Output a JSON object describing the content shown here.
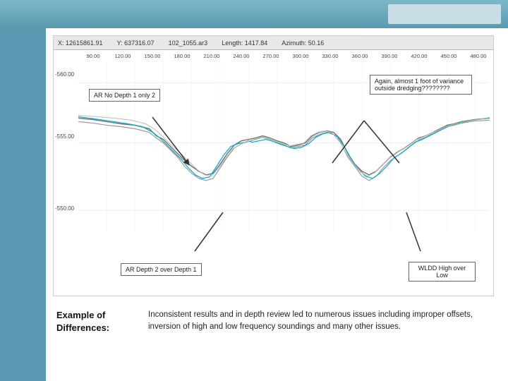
{
  "topbar": {
    "right_placeholder": ""
  },
  "chart": {
    "toolbar": {
      "x_coord": "X: 12615861.91",
      "y_coord": "Y: 637316.07",
      "filename": "102_1055.ar3",
      "length_label": "Length: 1417.84",
      "azimuth_label": "Azimuth: 50.16"
    },
    "x_labels": [
      "90.00",
      "120.00",
      "150.00",
      "180.00",
      "210.00",
      "240.00",
      "270.00",
      "300.00",
      "330.00",
      "360.00",
      "390.00",
      "420.00",
      "450.00",
      "480.00"
    ],
    "y_labels": [
      {
        "value": "-560.00",
        "position": 0.12
      },
      {
        "value": "-555.00",
        "position": 0.45
      },
      {
        "value": "-550.00",
        "position": 0.83
      }
    ],
    "annotations": {
      "ar_no_depth": "AR No Depth 1 only 2",
      "almost_1_foot": "Again, almost 1 foot of variance outside dredging????????",
      "ar_depth_2": "AR Depth 2 over Depth 1",
      "wldd_high": "WLDD High over Low"
    }
  },
  "bottom": {
    "label": "Example of\nDifferences:",
    "description": "Inconsistent results and in depth review led to numerous issues including improper offsets, inversion of high and low frequency soundings and many other issues."
  }
}
